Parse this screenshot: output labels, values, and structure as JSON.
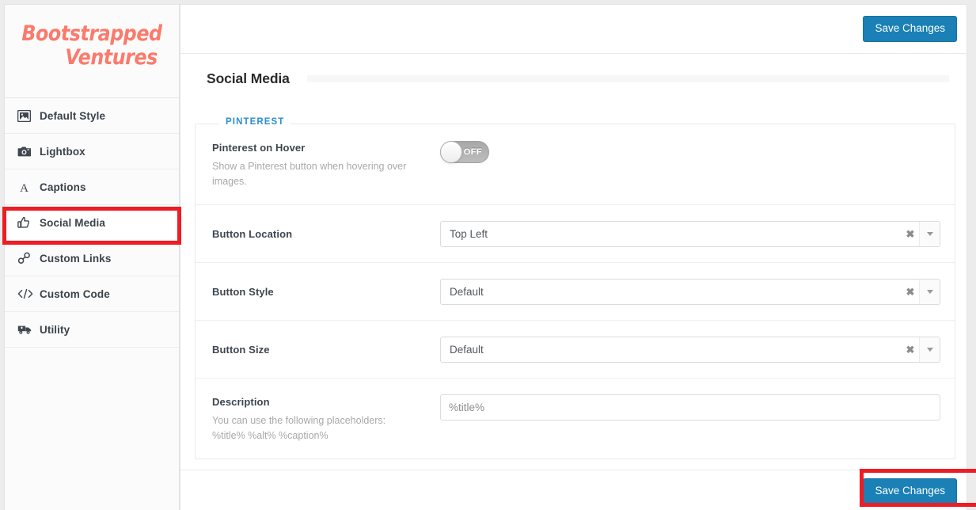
{
  "brand": {
    "line1": "Bootstrapped",
    "line2": "Ventures",
    "color": "#fb7a6b"
  },
  "sidebar": {
    "items": [
      {
        "label": "Default Style",
        "icon": "image-icon",
        "active": false
      },
      {
        "label": "Lightbox",
        "icon": "camera-icon",
        "active": false
      },
      {
        "label": "Captions",
        "icon": "text-a-icon",
        "active": false
      },
      {
        "label": "Social Media",
        "icon": "thumbs-up-icon",
        "active": true
      },
      {
        "label": "Custom Links",
        "icon": "link-icon",
        "active": false
      },
      {
        "label": "Custom Code",
        "icon": "code-icon",
        "active": false
      },
      {
        "label": "Utility",
        "icon": "ambulance-icon",
        "active": false
      }
    ]
  },
  "topbar": {
    "save_label": "Save Changes"
  },
  "page": {
    "title": "Social Media"
  },
  "fieldset": {
    "legend": "PINTEREST",
    "rows": [
      {
        "label": "Pinterest on Hover",
        "hint": "Show a Pinterest button when hovering over images.",
        "control": "toggle",
        "toggle_state": "OFF"
      },
      {
        "label": "Button Location",
        "hint": "",
        "control": "select",
        "value": "Top Left",
        "clear_glyph": "✖"
      },
      {
        "label": "Button Style",
        "hint": "",
        "control": "select",
        "value": "Default",
        "clear_glyph": "✖"
      },
      {
        "label": "Button Size",
        "hint": "",
        "control": "select",
        "value": "Default",
        "clear_glyph": "✖"
      },
      {
        "label": "Description",
        "hint": "You can use the following placeholders: %title% %alt% %caption%",
        "control": "text",
        "value": "%title%",
        "placeholder": "%title%"
      }
    ]
  },
  "footer": {
    "save_label": "Save Changes"
  },
  "annotations": {
    "color": "#ee1c24",
    "targets": [
      "sidebar-item-social-media",
      "footer-save-button"
    ]
  },
  "colors": {
    "accent_blue": "#1a80b6",
    "legend_blue": "#2e8ece",
    "brand_coral": "#fb7a6b",
    "annotation_red": "#ee1c24"
  }
}
